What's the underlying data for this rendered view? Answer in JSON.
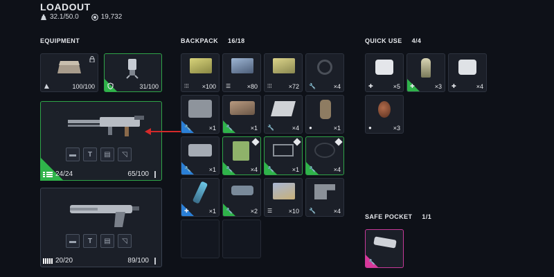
{
  "header": {
    "title": "LOADOUT",
    "weight": "32.1/50.0",
    "currency": "19,732"
  },
  "equipment": {
    "label": "EQUIPMENT",
    "augment": {
      "durability": "100/100",
      "icon": "augment-icon"
    },
    "shield": {
      "durability": "31/100",
      "icon": "shield-icon"
    },
    "primary_weapon": {
      "ammo": "24/24",
      "durability": "65/100"
    },
    "secondary_weapon": {
      "ammo": "20/20",
      "durability": "89/100"
    }
  },
  "backpack": {
    "label": "BACKPACK",
    "count": "16/18",
    "slots": [
      {
        "qty": "×100",
        "tag": "ammo",
        "rarity": "none"
      },
      {
        "qty": "×80",
        "tag": "ammo",
        "rarity": "none"
      },
      {
        "qty": "×72",
        "tag": "ammo",
        "rarity": "none"
      },
      {
        "qty": "×4",
        "tag": "wrench",
        "rarity": "none"
      },
      {
        "qty": "×1",
        "tag": "wrench",
        "rarity": "blue"
      },
      {
        "qty": "×1",
        "tag": "wrench",
        "rarity": "green"
      },
      {
        "qty": "×4",
        "tag": "wrench",
        "rarity": "none"
      },
      {
        "qty": "×1",
        "tag": "grenade",
        "rarity": "none"
      },
      {
        "qty": "×1",
        "tag": "wrench",
        "rarity": "blue"
      },
      {
        "qty": "×4",
        "tag": "wrench",
        "rarity": "green"
      },
      {
        "qty": "×1",
        "tag": "wrench",
        "rarity": "green"
      },
      {
        "qty": "×4",
        "tag": "wrench",
        "rarity": "green"
      },
      {
        "qty": "×1",
        "tag": "plus",
        "rarity": "blue"
      },
      {
        "qty": "×2",
        "tag": "wrench",
        "rarity": "green"
      },
      {
        "qty": "×10",
        "tag": "ammo",
        "rarity": "none"
      },
      {
        "qty": "×4",
        "tag": "wrench",
        "rarity": "none"
      }
    ]
  },
  "quick_use": {
    "label": "QUICK USE",
    "count": "4/4",
    "slots": [
      {
        "qty": "×5",
        "tag": "plus"
      },
      {
        "qty": "×3",
        "tag": "plus"
      },
      {
        "qty": "×4",
        "tag": "plus"
      },
      {
        "qty": "×3",
        "tag": "grenade"
      }
    ]
  },
  "safe_pocket": {
    "label": "SAFE POCKET",
    "count": "1/1"
  },
  "colors": {
    "background": "#0e1118",
    "uncommon": "#2fb34a",
    "rare": "#2a7fd6",
    "epic": "#d8389a",
    "indicator_arrow": "#d42a2a"
  }
}
